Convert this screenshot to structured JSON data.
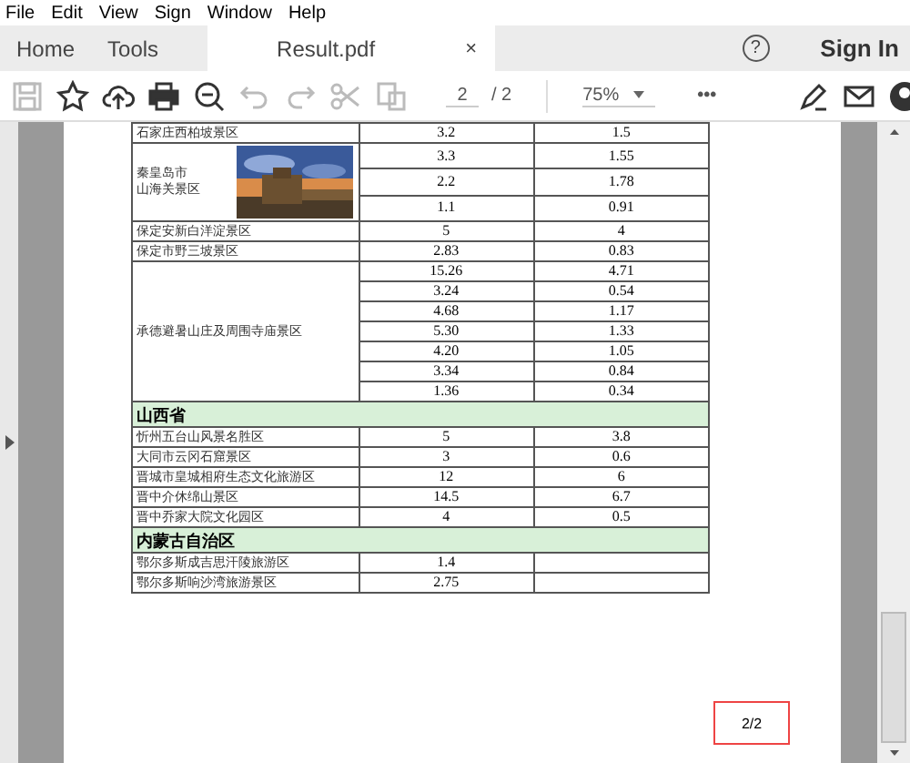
{
  "menu": [
    "File",
    "Edit",
    "View",
    "Sign",
    "Window",
    "Help"
  ],
  "tabs": [
    {
      "label": "Home",
      "selected": false
    },
    {
      "label": "Tools",
      "selected": false
    },
    {
      "label": "Result.pdf",
      "selected": true,
      "close": "×"
    }
  ],
  "help": "?",
  "sign_in": "Sign In",
  "toolbar": {
    "tools": [
      {
        "disabled": true
      },
      {
        "disabled": false
      },
      {
        "disabled": false
      },
      {
        "disabled": false
      },
      {
        "disabled": false
      },
      {
        "disabled": true
      },
      {
        "disabled": true
      },
      {
        "disabled": true
      },
      {
        "disabled": true
      }
    ],
    "page": "2",
    "pages": "/ 2",
    "zoom": "75%",
    "more": "•••"
  },
  "table": {
    "rows": [
      {
        "kind": "group",
        "name": "石家庄西柏坡景区",
        "values": [
          [
            "3.2",
            "1.5"
          ]
        ]
      },
      {
        "kind": "group",
        "lines": [
          "秦皇岛市",
          "山海关景区"
        ],
        "picture": true,
        "values": [
          [
            "3.3",
            "1.55"
          ],
          [
            "2.2",
            "1.78"
          ],
          [
            "1.1",
            "0.91"
          ]
        ]
      },
      {
        "kind": "group",
        "name": "保定安新白洋淀景区",
        "values": [
          [
            "5",
            "4"
          ]
        ]
      },
      {
        "kind": "group",
        "name": "保定市野三坡景区",
        "values": [
          [
            "2.83",
            "0.83"
          ]
        ]
      },
      {
        "kind": "group",
        "name": "承德避暑山庄及周围寺庙景区",
        "values": [
          [
            "15.26",
            "4.71"
          ],
          [
            "3.24",
            "0.54"
          ],
          [
            "4.68",
            "1.17"
          ],
          [
            "5.30",
            "1.33"
          ],
          [
            "4.20",
            "1.05"
          ],
          [
            "3.34",
            "0.84"
          ],
          [
            "1.36",
            "0.34"
          ]
        ]
      },
      {
        "kind": "section",
        "name": "山西省"
      },
      {
        "kind": "group",
        "name": "忻州五台山风景名胜区",
        "values": [
          [
            "5",
            "3.8"
          ]
        ]
      },
      {
        "kind": "group",
        "name": "大同市云冈石窟景区",
        "values": [
          [
            "3",
            "0.6"
          ]
        ]
      },
      {
        "kind": "group",
        "name": "晋城市皇城相府生态文化旅游区",
        "values": [
          [
            "12",
            "6"
          ]
        ]
      },
      {
        "kind": "group",
        "name": "晋中介休绵山景区",
        "values": [
          [
            "14.5",
            "6.7"
          ]
        ]
      },
      {
        "kind": "group",
        "name": "晋中乔家大院文化园区",
        "values": [
          [
            "4",
            "0.5"
          ]
        ]
      },
      {
        "kind": "section",
        "name": "内蒙古自治区"
      },
      {
        "kind": "group",
        "name": "鄂尔多斯成吉思汗陵旅游区",
        "values": [
          [
            "1.4"
          ]
        ]
      },
      {
        "kind": "group",
        "name": "鄂尔多斯响沙湾旅游景区",
        "values": [
          [
            "2.75"
          ]
        ]
      }
    ]
  },
  "page_label": "2/2"
}
